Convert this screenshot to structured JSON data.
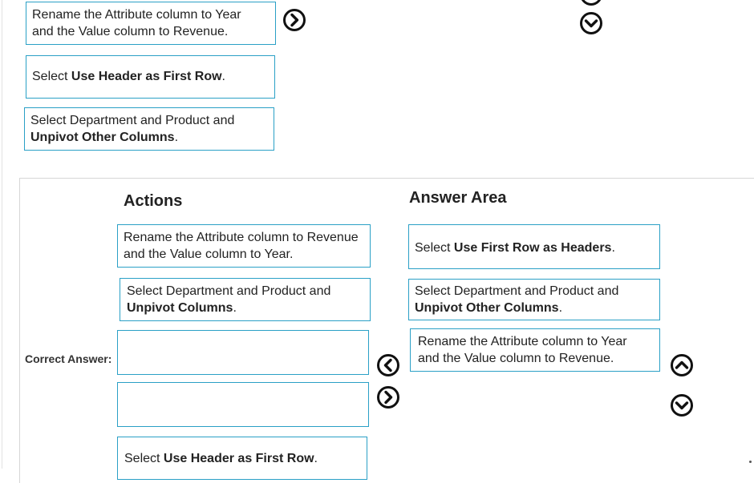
{
  "question_area": {
    "items": [
      {
        "pre": "",
        "bold": "",
        "post": "",
        "line1": "Rename the Attribute column to Year",
        "line2": "and the Value column to Revenue."
      },
      {
        "pre": "Select ",
        "bold": "Use Header as First Row",
        "post": "."
      },
      {
        "line1": "Select Department and Product and",
        "bold": "Unpivot Other Columns",
        "post": "."
      }
    ]
  },
  "correct_answer": {
    "label": "Correct Answer:",
    "actions_heading": "Actions",
    "answer_heading": "Answer Area",
    "actions": [
      {
        "line1": "Rename the Attribute column to Revenue",
        "line2": "and the Value column to Year."
      },
      {
        "line1": "Select Department and Product and",
        "bold": "Unpivot Columns",
        "post": "."
      },
      {
        "empty": true
      },
      {
        "empty": true
      },
      {
        "pre": "Select ",
        "bold": "Use Header as First Row",
        "post": "."
      }
    ],
    "answers": [
      {
        "pre": "Select ",
        "bold": "Use First Row as Headers",
        "post": "."
      },
      {
        "line1": "Select Department and Product and",
        "bold": "Unpivot Other Columns",
        "post": "."
      },
      {
        "line1": "Rename the Attribute column to Year",
        "line2": "and the Value column to Revenue."
      }
    ]
  },
  "colors": {
    "box_border": "#2aa0c6",
    "arrow": "#111111"
  },
  "icons": {
    "right": "chevron-right-circle-icon",
    "left": "chevron-left-circle-icon",
    "up": "chevron-up-circle-icon",
    "down": "chevron-down-circle-icon"
  }
}
